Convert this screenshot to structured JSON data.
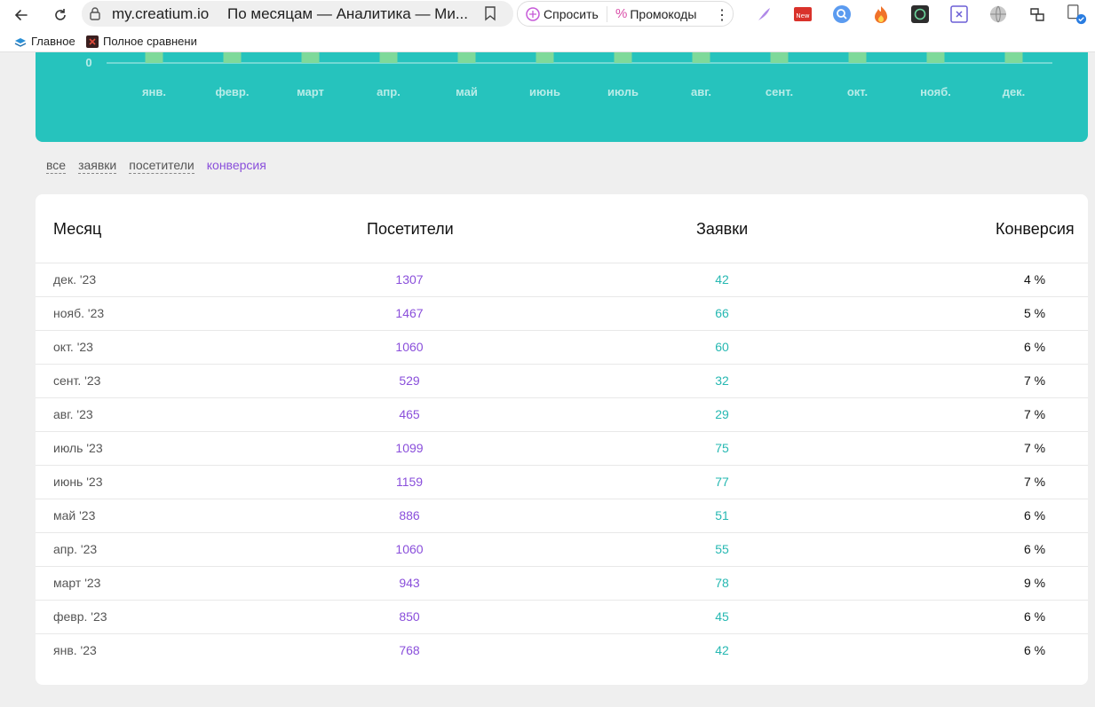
{
  "browser": {
    "url": "my.creatium.io",
    "tab_title": "По месяцам — Аналитика — Ми...",
    "ask_label": "Спросить",
    "promo_label": "Промокоды",
    "bookmarks": [
      "Главное",
      "Полное сравнени"
    ],
    "extension_icons": [
      "feather-icon",
      "new-badge-icon",
      "search-circle-icon",
      "fire-icon",
      "chatgpt-icon",
      "close-box-icon",
      "globe-icon",
      "translate-icon",
      "shield-check-icon"
    ]
  },
  "chart": {
    "zero_label": "0",
    "months": [
      "янв.",
      "февр.",
      "март",
      "апр.",
      "май",
      "июнь",
      "июль",
      "авг.",
      "сент.",
      "окт.",
      "нояб.",
      "дек."
    ],
    "background": "#26c3bd",
    "bar_color": "#7fd99a"
  },
  "filters": {
    "items": [
      {
        "label": "все",
        "active": false
      },
      {
        "label": "заявки",
        "active": false
      },
      {
        "label": "посетители",
        "active": false
      },
      {
        "label": "конверсия",
        "active": true
      }
    ]
  },
  "table": {
    "headers": {
      "month": "Месяц",
      "visitors": "Посетители",
      "requests": "Заявки",
      "conversion": "Конверсия"
    },
    "rows": [
      {
        "month": "дек. '23",
        "visitors": "1307",
        "requests": "42",
        "conversion": "4 %"
      },
      {
        "month": "нояб. '23",
        "visitors": "1467",
        "requests": "66",
        "conversion": "5 %"
      },
      {
        "month": "окт. '23",
        "visitors": "1060",
        "requests": "60",
        "conversion": "6 %"
      },
      {
        "month": "сент. '23",
        "visitors": "529",
        "requests": "32",
        "conversion": "7 %"
      },
      {
        "month": "авг. '23",
        "visitors": "465",
        "requests": "29",
        "conversion": "7 %"
      },
      {
        "month": "июль '23",
        "visitors": "1099",
        "requests": "75",
        "conversion": "7 %"
      },
      {
        "month": "июнь '23",
        "visitors": "1159",
        "requests": "77",
        "conversion": "7 %"
      },
      {
        "month": "май '23",
        "visitors": "886",
        "requests": "51",
        "conversion": "6 %"
      },
      {
        "month": "апр. '23",
        "visitors": "1060",
        "requests": "55",
        "conversion": "6 %"
      },
      {
        "month": "март '23",
        "visitors": "943",
        "requests": "78",
        "conversion": "9 %"
      },
      {
        "month": "февр. '23",
        "visitors": "850",
        "requests": "45",
        "conversion": "6 %"
      },
      {
        "month": "янв. '23",
        "visitors": "768",
        "requests": "42",
        "conversion": "6 %"
      }
    ]
  }
}
